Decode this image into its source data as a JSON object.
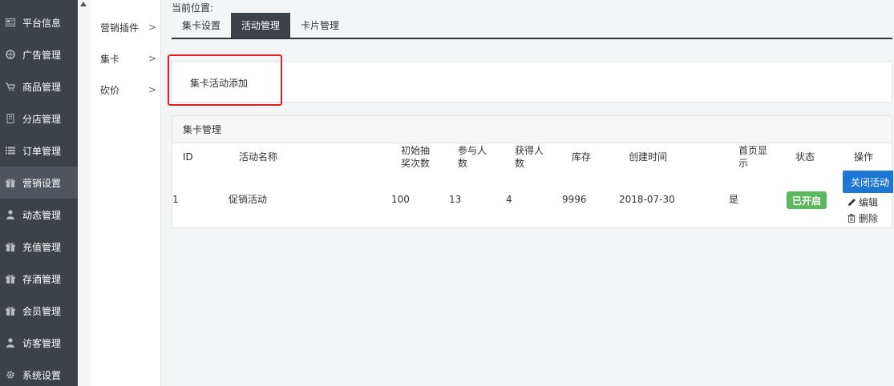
{
  "sidebar": {
    "items": [
      {
        "label": "平台信息",
        "icon": "newspaper-icon"
      },
      {
        "label": "广告管理",
        "icon": "globe-icon"
      },
      {
        "label": "商品管理",
        "icon": "cart-icon"
      },
      {
        "label": "分店管理",
        "icon": "building-icon"
      },
      {
        "label": "订单管理",
        "icon": "list-icon"
      },
      {
        "label": "营销设置",
        "icon": "gift-icon"
      },
      {
        "label": "动态管理",
        "icon": "user-icon"
      },
      {
        "label": "充值管理",
        "icon": "gift-icon"
      },
      {
        "label": "存酒管理",
        "icon": "gift-icon"
      },
      {
        "label": "会员管理",
        "icon": "gift-icon"
      },
      {
        "label": "访客管理",
        "icon": "user-icon"
      },
      {
        "label": "系统设置",
        "icon": "gear-icon"
      }
    ],
    "active_index": 5
  },
  "submenu": {
    "items": [
      {
        "label": "营销插件",
        "chevron": ">"
      },
      {
        "label": "集卡",
        "chevron": ">"
      },
      {
        "label": "砍价",
        "chevron": ">"
      }
    ]
  },
  "breadcrumb": {
    "label": "当前位置:"
  },
  "tabs": [
    {
      "label": "集卡设置"
    },
    {
      "label": "活动管理"
    },
    {
      "label": "卡片管理"
    }
  ],
  "active_tab": 1,
  "add_panel": {
    "link_label": "集卡活动添加"
  },
  "table": {
    "title": "集卡管理",
    "headers": {
      "id": "ID",
      "name": "活动名称",
      "initial_draws": "初始抽奖次数",
      "participants": "参与人数",
      "winners": "获得人数",
      "stock": "库存",
      "created": "创建时间",
      "homepage": "首页显示",
      "status": "状态",
      "actions": "操作"
    },
    "rows": [
      {
        "id": "1",
        "name": "促销活动",
        "initial_draws": "100",
        "participants": "13",
        "winners": "4",
        "stock": "9996",
        "created": "2018-07-30",
        "homepage": "是",
        "status": "已开启",
        "close_label": "关闭活动",
        "edit_label": "编辑",
        "delete_label": "删除"
      }
    ]
  },
  "colors": {
    "sidebar_bg": "#3d4148",
    "sidebar_active": "#50555d",
    "status_green": "#5cb85c",
    "primary_blue": "#1e76d4",
    "highlight_red": "#e02020"
  }
}
